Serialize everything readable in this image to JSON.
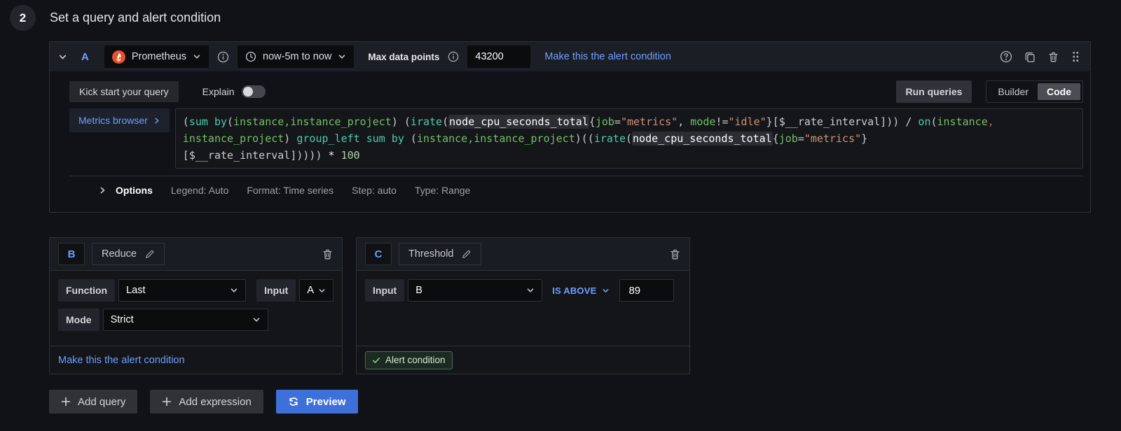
{
  "colors": {
    "accent_blue": "#6E9FFF",
    "preview_blue": "#3D71D9",
    "prometheus_orange": "#E6522C",
    "success_green": "#7FCF8E",
    "code_keyword_teal": "#4EC9B0",
    "code_label_green": "#73BF69",
    "code_string_orange": "#CE9178",
    "panel_border": "#2C3235",
    "background": "#111217"
  },
  "step": {
    "number": "2",
    "title": "Set a query and alert condition"
  },
  "query_header": {
    "ref_id": "A",
    "datasource": "Prometheus",
    "time_range": "now-5m to now",
    "max_data_points_label": "Max data points",
    "max_data_points_value": "43200",
    "make_alert_condition_link": "Make this the alert condition"
  },
  "toolbar": {
    "kick_start": "Kick start your query",
    "explain": "Explain",
    "run_queries": "Run queries",
    "builder": "Builder",
    "code": "Code"
  },
  "editor": {
    "metrics_browser": "Metrics browser",
    "lines": [
      [
        {
          "t": "(",
          "c": "p"
        },
        {
          "t": "sum",
          "c": "k"
        },
        {
          "t": " ",
          "c": "p"
        },
        {
          "t": "by",
          "c": "k"
        },
        {
          "t": "(",
          "c": "p"
        },
        {
          "t": "instance,instance_project",
          "c": "l"
        },
        {
          "t": ") (",
          "c": "p"
        },
        {
          "t": "irate",
          "c": "k"
        },
        {
          "t": "(",
          "c": "p"
        },
        {
          "t": "node_cpu_seconds_total",
          "c": "m"
        },
        {
          "t": "{",
          "c": "p"
        },
        {
          "t": "job",
          "c": "l"
        },
        {
          "t": "=",
          "c": "p"
        },
        {
          "t": "\"metrics\"",
          "c": "s"
        },
        {
          "t": ", ",
          "c": "p"
        },
        {
          "t": "mode",
          "c": "l"
        },
        {
          "t": "!=",
          "c": "p"
        },
        {
          "t": "\"idle\"",
          "c": "s"
        },
        {
          "t": "}[$__rate_interval])) / ",
          "c": "p"
        },
        {
          "t": "on",
          "c": "k"
        },
        {
          "t": "(",
          "c": "p"
        },
        {
          "t": "instance",
          "c": "l"
        },
        {
          "t": ",",
          "c": "r"
        }
      ],
      [
        {
          "t": "instance_project",
          "c": "l"
        },
        {
          "t": ") ",
          "c": "p"
        },
        {
          "t": "group_left",
          "c": "k"
        },
        {
          "t": " ",
          "c": "p"
        },
        {
          "t": "sum",
          "c": "k"
        },
        {
          "t": " ",
          "c": "p"
        },
        {
          "t": "by",
          "c": "k"
        },
        {
          "t": " (",
          "c": "p"
        },
        {
          "t": "instance,instance_project",
          "c": "l"
        },
        {
          "t": ")((",
          "c": "p"
        },
        {
          "t": "irate",
          "c": "k"
        },
        {
          "t": "(",
          "c": "p"
        },
        {
          "t": "node_cpu_seconds_total",
          "c": "m"
        },
        {
          "t": "{",
          "c": "p"
        },
        {
          "t": "job",
          "c": "l"
        },
        {
          "t": "=",
          "c": "p"
        },
        {
          "t": "\"metrics\"",
          "c": "s"
        },
        {
          "t": "}",
          "c": "p"
        }
      ],
      [
        {
          "t": "[$__rate_interval])))) ",
          "c": "p"
        },
        {
          "t": "* ",
          "c": "w"
        },
        {
          "t": "100",
          "c": "n"
        }
      ]
    ]
  },
  "options_row": {
    "options": "Options",
    "legend": "Legend: Auto",
    "format": "Format: Time series",
    "step": "Step: auto",
    "type": "Type: Range"
  },
  "reduce_panel": {
    "ref_id": "B",
    "title": "Reduce",
    "function_label": "Function",
    "function_value": "Last",
    "input_label": "Input",
    "input_value": "A",
    "mode_label": "Mode",
    "mode_value": "Strict",
    "make_alert_condition_link": "Make this the alert condition"
  },
  "threshold_panel": {
    "ref_id": "C",
    "title": "Threshold",
    "input_label": "Input",
    "input_value": "B",
    "condition": "IS ABOVE",
    "threshold_value": "89",
    "alert_condition_badge": "Alert condition"
  },
  "actions": {
    "add_query": "Add query",
    "add_expression": "Add expression",
    "preview": "Preview"
  }
}
